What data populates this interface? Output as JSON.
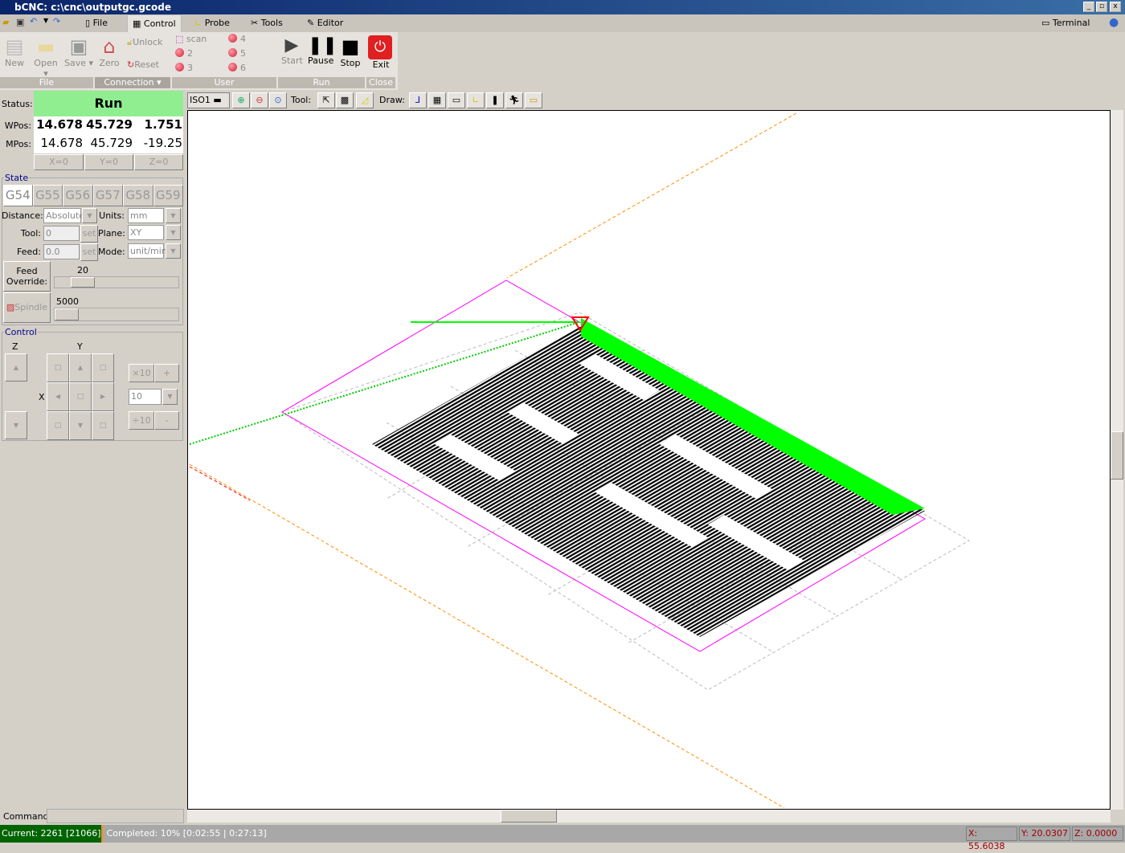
{
  "window": {
    "title": "bCNC: c:\\cnc\\outputgc.gcode",
    "min": "_",
    "max": "▫",
    "close": "x"
  },
  "menu": {
    "tabs": [
      {
        "label": "File",
        "icon": "file-icon"
      },
      {
        "label": "Control",
        "icon": "control-icon"
      },
      {
        "label": "Probe",
        "icon": "ruler-icon"
      },
      {
        "label": "Tools",
        "icon": "tools-icon"
      },
      {
        "label": "Editor",
        "icon": "pencil-icon"
      }
    ],
    "terminal": "Terminal"
  },
  "ribbon": {
    "file": {
      "label": "File",
      "new": "New",
      "open": "Open",
      "save": "Save"
    },
    "connection": {
      "label": "Connection",
      "zero": "Zero",
      "unlock": "Unlock",
      "reset": "Reset"
    },
    "user": {
      "label": "User",
      "items": [
        "scan",
        "2",
        "3",
        "4",
        "5",
        "6"
      ]
    },
    "run": {
      "label": "Run",
      "start": "Start",
      "pause": "Pause",
      "stop": "Stop"
    },
    "close": {
      "label": "Close",
      "exit": "Exit"
    }
  },
  "status": {
    "label": "Status:",
    "value": "Run",
    "color": "#90ee90"
  },
  "position": {
    "wpos_label": "WPos:",
    "mpos_label": "MPos:",
    "wpos": [
      "14.678",
      "45.729",
      "1.751"
    ],
    "mpos": [
      "14.678",
      "45.729",
      "-19.25"
    ],
    "zero_buttons": [
      "X=0",
      "Y=0",
      "Z=0"
    ]
  },
  "state": {
    "legend": "State",
    "wcs": [
      "G54",
      "G55",
      "G56",
      "G57",
      "G58",
      "G59"
    ],
    "distance_label": "Distance:",
    "distance": "Absolute",
    "units_label": "Units:",
    "units": "mm",
    "tool_label": "Tool:",
    "tool": "0",
    "plane_label": "Plane:",
    "plane": "XY",
    "feed_label": "Feed:",
    "feed": "0.0",
    "mode_label": "Mode:",
    "mode": "unit/min",
    "set": "set",
    "feed_override_label": "Feed Override:",
    "feed_override": "20",
    "spindle_label": "Spindle",
    "spindle": "5000"
  },
  "control": {
    "legend": "Control",
    "z": "Z",
    "y": "Y",
    "x": "X",
    "x10": "×10",
    "plus": "+",
    "step": "10",
    "div10": "÷10",
    "minus": "-"
  },
  "command": {
    "label": "Command:",
    "value": ""
  },
  "canvas_toolbar": {
    "view": "ISO1",
    "tool_label": "Tool:",
    "draw_label": "Draw:"
  },
  "statusbar": {
    "text": "Current: 2261 [21066]  Completed: 10% [0:02:55 | 0:27:13]",
    "progress_percent": 10,
    "x": "X: 55.6038",
    "y": "Y: 20.0307",
    "z": "Z: 0.0000"
  },
  "colors": {
    "progress": "#006400",
    "toolpath_done": "#00ff00",
    "margin": "#ff00ff",
    "axis": "#ff8c00"
  }
}
